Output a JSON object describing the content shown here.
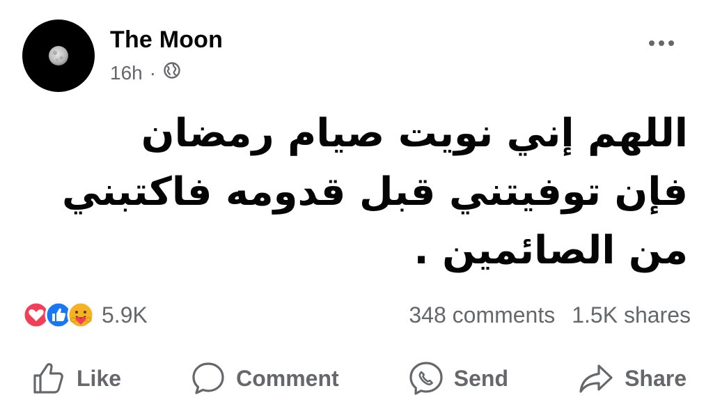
{
  "post": {
    "author": "The Moon",
    "time": "16h",
    "separator": "·",
    "privacy_icon": "globe-icon",
    "more_icon": "more-dots-icon",
    "text": "اللهم إني نويت صيام رمضان فإن توفيتني قبل قدومه فاكتبني من الصائمين ."
  },
  "stats": {
    "reaction_icons": [
      "love-reaction-icon",
      "like-reaction-icon",
      "care-reaction-icon"
    ],
    "reactions_count": "5.9K",
    "comments": "348 comments",
    "shares": "1.5K shares"
  },
  "actions": [
    {
      "label": "Like",
      "icon": "thumbs-up-icon"
    },
    {
      "label": "Comment",
      "icon": "comment-bubble-icon"
    },
    {
      "label": "Send",
      "icon": "messenger-icon"
    },
    {
      "label": "Share",
      "icon": "share-arrow-icon"
    }
  ],
  "colors": {
    "text": "#050505",
    "secondary": "#65676b",
    "like_blue": "#1877f2",
    "love_red": "#f33e58",
    "care_yellow": "#f7b125"
  }
}
